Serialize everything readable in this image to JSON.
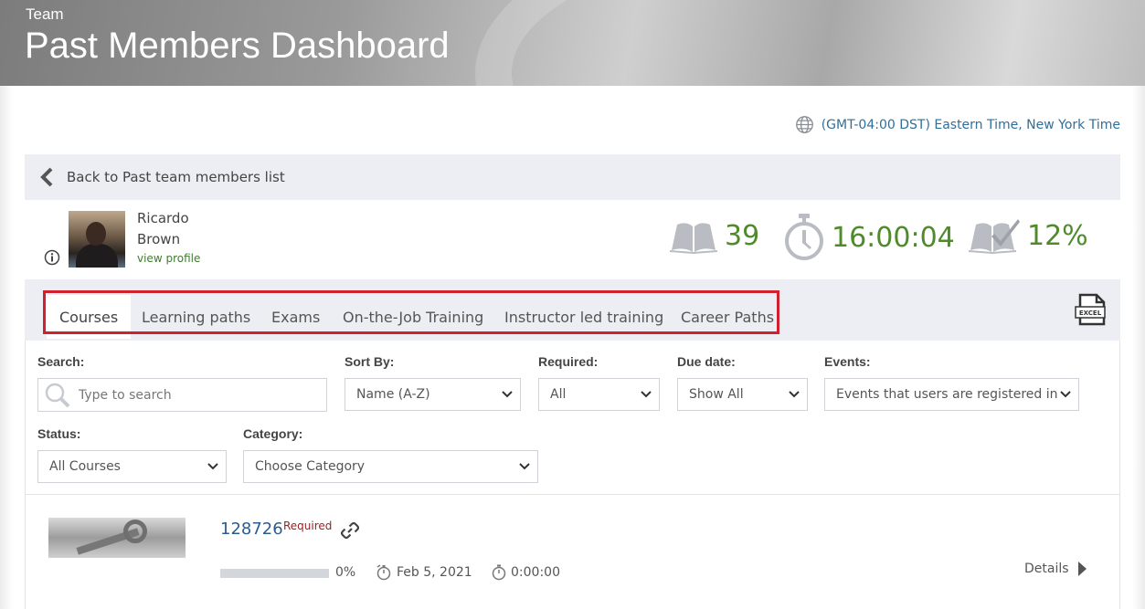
{
  "header": {
    "subtitle": "Team",
    "title": "Past Members Dashboard"
  },
  "timezone": {
    "label": "(GMT-04:00 DST) Eastern Time, New York Time",
    "icon": "globe-icon"
  },
  "back": {
    "label": "Back to Past team members list",
    "icon": "chevron-left-icon"
  },
  "user": {
    "first_name": "Ricardo",
    "last_name": "Brown",
    "profile_link": "view profile"
  },
  "stats": {
    "courses": "39",
    "time": "16:00:04",
    "completion": "12%"
  },
  "tabs": [
    {
      "label": "Courses",
      "active": true
    },
    {
      "label": "Learning paths",
      "active": false
    },
    {
      "label": "Exams",
      "active": false
    },
    {
      "label": "On-the-Job Training",
      "active": false
    },
    {
      "label": "Instructor led training",
      "active": false
    },
    {
      "label": "Career Paths",
      "active": false
    }
  ],
  "filters": {
    "search": {
      "label": "Search:",
      "placeholder": "Type to search"
    },
    "sort": {
      "label": "Sort By:",
      "value": "Name (A-Z)"
    },
    "required": {
      "label": "Required:",
      "value": "All"
    },
    "due": {
      "label": "Due date:",
      "value": "Show All"
    },
    "events": {
      "label": "Events:",
      "value": "Events that users are registered in"
    },
    "status": {
      "label": "Status:",
      "value": "All Courses"
    },
    "category": {
      "label": "Category:",
      "value": "Choose Category"
    }
  },
  "courses": [
    {
      "title": "128726",
      "required_label": "Required",
      "progress_pct": 0,
      "progress_text": "0%",
      "due_date": "Feb 5, 2021",
      "time_spent": "0:00:00",
      "details_label": "Details"
    }
  ],
  "colors": {
    "accent_green": "#4f8a2c",
    "link_blue": "#2f6f9a",
    "highlight_red": "#d0212e"
  }
}
